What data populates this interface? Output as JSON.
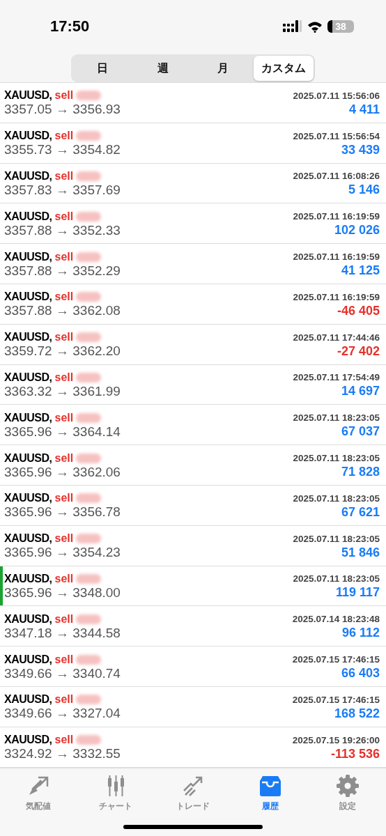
{
  "status_bar": {
    "time": "17:50",
    "battery": "38"
  },
  "segments": [
    {
      "label": "日",
      "selected": false
    },
    {
      "label": "週",
      "selected": false
    },
    {
      "label": "月",
      "selected": false
    },
    {
      "label": "カスタム",
      "selected": true
    }
  ],
  "trades": [
    {
      "symbol": "XAUUSD,",
      "side": "sell",
      "time": "2025.07.11 15:56:06",
      "open": "3357.05",
      "arrow": "→",
      "close": "3356.93",
      "profit": "4 411",
      "loss": false,
      "highlighted": false
    },
    {
      "symbol": "XAUUSD,",
      "side": "sell",
      "time": "2025.07.11 15:56:54",
      "open": "3355.73",
      "arrow": "→",
      "close": "3354.82",
      "profit": "33 439",
      "loss": false,
      "highlighted": false
    },
    {
      "symbol": "XAUUSD,",
      "side": "sell",
      "time": "2025.07.11 16:08:26",
      "open": "3357.83",
      "arrow": "→",
      "close": "3357.69",
      "profit": "5 146",
      "loss": false,
      "highlighted": false
    },
    {
      "symbol": "XAUUSD,",
      "side": "sell",
      "time": "2025.07.11 16:19:59",
      "open": "3357.88",
      "arrow": "→",
      "close": "3352.33",
      "profit": "102 026",
      "loss": false,
      "highlighted": false
    },
    {
      "symbol": "XAUUSD,",
      "side": "sell",
      "time": "2025.07.11 16:19:59",
      "open": "3357.88",
      "arrow": "→",
      "close": "3352.29",
      "profit": "41 125",
      "loss": false,
      "highlighted": false
    },
    {
      "symbol": "XAUUSD,",
      "side": "sell",
      "time": "2025.07.11 16:19:59",
      "open": "3357.88",
      "arrow": "→",
      "close": "3362.08",
      "profit": "-46 405",
      "loss": true,
      "highlighted": false
    },
    {
      "symbol": "XAUUSD,",
      "side": "sell",
      "time": "2025.07.11 17:44:46",
      "open": "3359.72",
      "arrow": "→",
      "close": "3362.20",
      "profit": "-27 402",
      "loss": true,
      "highlighted": false
    },
    {
      "symbol": "XAUUSD,",
      "side": "sell",
      "time": "2025.07.11 17:54:49",
      "open": "3363.32",
      "arrow": "→",
      "close": "3361.99",
      "profit": "14 697",
      "loss": false,
      "highlighted": false
    },
    {
      "symbol": "XAUUSD,",
      "side": "sell",
      "time": "2025.07.11 18:23:05",
      "open": "3365.96",
      "arrow": "→",
      "close": "3364.14",
      "profit": "67 037",
      "loss": false,
      "highlighted": false
    },
    {
      "symbol": "XAUUSD,",
      "side": "sell",
      "time": "2025.07.11 18:23:05",
      "open": "3365.96",
      "arrow": "→",
      "close": "3362.06",
      "profit": "71 828",
      "loss": false,
      "highlighted": false
    },
    {
      "symbol": "XAUUSD,",
      "side": "sell",
      "time": "2025.07.11 18:23:05",
      "open": "3365.96",
      "arrow": "→",
      "close": "3356.78",
      "profit": "67 621",
      "loss": false,
      "highlighted": false
    },
    {
      "symbol": "XAUUSD,",
      "side": "sell",
      "time": "2025.07.11 18:23:05",
      "open": "3365.96",
      "arrow": "→",
      "close": "3354.23",
      "profit": "51 846",
      "loss": false,
      "highlighted": false
    },
    {
      "symbol": "XAUUSD,",
      "side": "sell",
      "time": "2025.07.11 18:23:05",
      "open": "3365.96",
      "arrow": "→",
      "close": "3348.00",
      "profit": "119 117",
      "loss": false,
      "highlighted": true
    },
    {
      "symbol": "XAUUSD,",
      "side": "sell",
      "time": "2025.07.14 18:23:48",
      "open": "3347.18",
      "arrow": "→",
      "close": "3344.58",
      "profit": "96 112",
      "loss": false,
      "highlighted": false
    },
    {
      "symbol": "XAUUSD,",
      "side": "sell",
      "time": "2025.07.15 17:46:15",
      "open": "3349.66",
      "arrow": "→",
      "close": "3340.74",
      "profit": "66 403",
      "loss": false,
      "highlighted": false
    },
    {
      "symbol": "XAUUSD,",
      "side": "sell",
      "time": "2025.07.15 17:46:15",
      "open": "3349.66",
      "arrow": "→",
      "close": "3327.04",
      "profit": "168 522",
      "loss": false,
      "highlighted": false
    },
    {
      "symbol": "XAUUSD,",
      "side": "sell",
      "time": "2025.07.15 19:26:00",
      "open": "3324.92",
      "arrow": "→",
      "close": "3332.55",
      "profit": "-113 536",
      "loss": true,
      "highlighted": false
    }
  ],
  "tab_bar": [
    {
      "label": "気配値",
      "kind": "quotes",
      "selected": false
    },
    {
      "label": "チャート",
      "kind": "chart",
      "selected": false
    },
    {
      "label": "トレード",
      "kind": "trade",
      "selected": false
    },
    {
      "label": "履歴",
      "kind": "history",
      "selected": true
    },
    {
      "label": "設定",
      "kind": "settings",
      "selected": false
    }
  ]
}
